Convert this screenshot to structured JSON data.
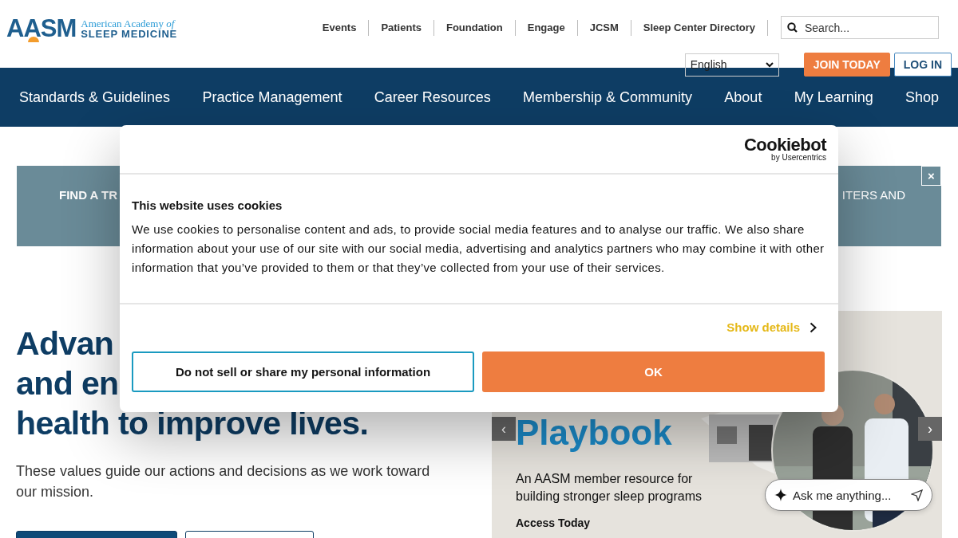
{
  "header": {
    "logo": {
      "mark": "AASM",
      "line1": "American Academy *of*",
      "line2": "SLEEP MEDICINE"
    },
    "utility_links": [
      "Events",
      "Patients",
      "Foundation",
      "Engage",
      "JCSM",
      "Sleep Center Directory"
    ],
    "search": {
      "placeholder": "Search..."
    },
    "language": {
      "value": "English"
    },
    "join_button": "JOIN TODAY",
    "login_button": "LOG IN"
  },
  "main_nav": [
    "Standards & Guidelines",
    "Practice Management",
    "Career Resources",
    "Membership & Community",
    "About",
    "My Learning",
    "Shop"
  ],
  "banner": {
    "text_left": "FIND A TR",
    "text_right": "ITERS AND",
    "close": "×"
  },
  "hero": {
    "heading_lines": [
      "Advan",
      "and en",
      "health to improve lives."
    ],
    "body": "These values guide our actions and decisions as we work toward our mission."
  },
  "carousel": {
    "title": "Playbook",
    "subtitle": "An AASM member resource for building stronger sleep programs",
    "link": "Access Today",
    "prev": "‹",
    "next": "›"
  },
  "chat": {
    "placeholder": "Ask me anything..."
  },
  "cookie_dialog": {
    "brand": "Cookiebot",
    "brand_sub": "by Usercentrics",
    "title": "This website uses cookies",
    "body": "We use cookies to personalise content and ads, to provide social media features and to analyse our traffic. We also share information about your use of our site with our social media, advertising and analytics partners who may combine it with other information that you’ve provided to them or that they’ve collected from your use of their services.",
    "show_details": "Show details",
    "buttons": [
      {
        "label": "Do not sell or share my personal information",
        "kind": "outline"
      },
      {
        "label": "OK",
        "kind": "primary"
      }
    ]
  }
}
